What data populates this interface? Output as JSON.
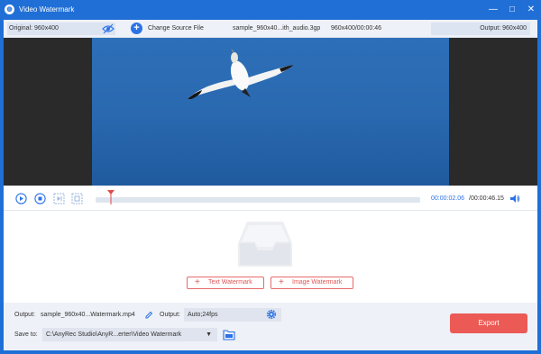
{
  "window": {
    "title": "Video Watermark",
    "app_icon": "water-drop-icon",
    "accent": "#1f6fd6"
  },
  "infobar": {
    "original": "Original: 960x400",
    "change_source": "Change Source File",
    "filename": "sample_960x40...ith_audio.3gp",
    "file_meta": "960x400/00:00:46",
    "output_size": "Output: 960x400"
  },
  "player": {
    "current_time": "00:00:02.06",
    "total_time": "/00:00:46.15",
    "progress": 0.046
  },
  "watermark": {
    "text_button": "Text Watermark",
    "image_button": "Image Watermark"
  },
  "bottom": {
    "output_label": "Output:",
    "output_file": "sample_960x40...Watermark.mp4",
    "output_format_label": "Output:",
    "output_format": "Auto;24fps",
    "save_to_label": "Save to:",
    "save_path": "C:\\AnyRec Studio\\AnyR...erter\\Video Watermark",
    "export_label": "Export",
    "export_color": "#ec5a55"
  }
}
